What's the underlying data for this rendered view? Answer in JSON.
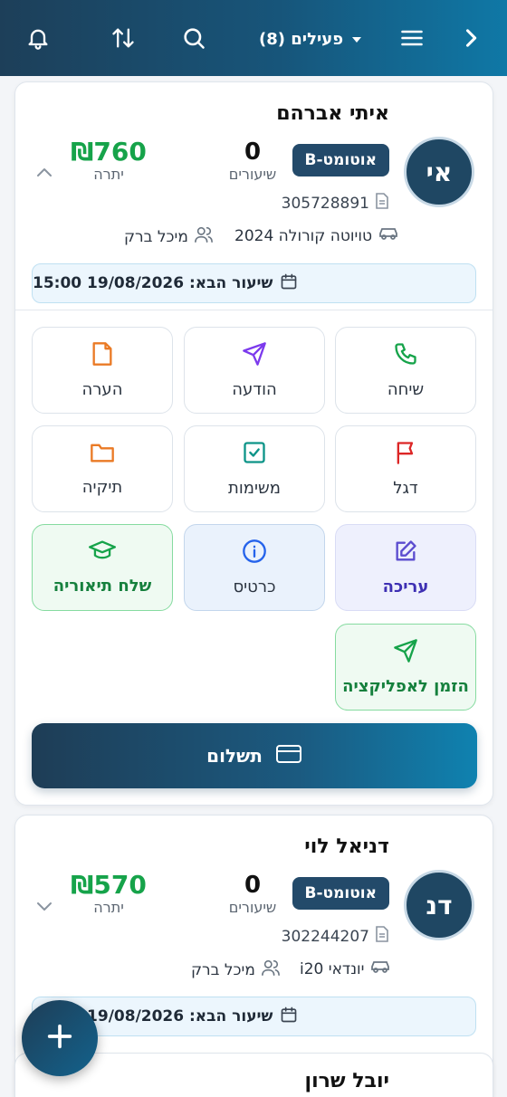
{
  "header": {
    "filter_label": "פעילים (8)",
    "icons": [
      "bell-icon",
      "sort-icon",
      "search-icon",
      "menu-icon",
      "chevron-right-icon"
    ]
  },
  "students": [
    {
      "name": "איתי אברהם",
      "initials": "אי",
      "license": "B-אוטומט",
      "lessons_count": "0",
      "lessons_label": "שיעורים",
      "balance": "₪760",
      "balance_label": "יתרה",
      "id_number": "305728891",
      "car": "טויוטה קורולה 2024",
      "instructor": "מיכל ברק",
      "next_lesson": "שיעור הבא: 19/08/2026 15:00",
      "expanded": true
    },
    {
      "name": "דניאל לוי",
      "initials": "דנ",
      "license": "B-אוטומט",
      "lessons_count": "0",
      "lessons_label": "שיעורים",
      "balance": "₪570",
      "balance_label": "יתרה",
      "id_number": "302244207",
      "car": "יונדאי i20",
      "instructor": "מיכל ברק",
      "next_lesson": "שיעור הבא: 19/08/2026 17:30",
      "expanded": false
    },
    {
      "name": "יובל שרון"
    }
  ],
  "actions": {
    "call": "שיחה",
    "message": "הודעה",
    "note": "הערה",
    "flag": "דגל",
    "tasks": "משימות",
    "folder": "תיקיה",
    "edit": "עריכה",
    "card": "כרטיס",
    "send_theory": "שלח תיאוריה",
    "invite_app": "הזמן לאפליקציה",
    "payment": "תשלום"
  },
  "colors": {
    "header_gradient_start": "#1d3f59",
    "header_gradient_end": "#0f78a6",
    "balance_green": "#16a34a",
    "badge": "#234a6a"
  }
}
